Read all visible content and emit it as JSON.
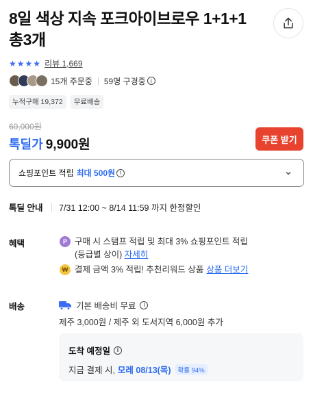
{
  "product": {
    "title": "8일 색상 지속 포크아이브로우 1+1+1 총3개"
  },
  "rating": {
    "stars": 4,
    "review_text": "리뷰 1,669"
  },
  "buyers": {
    "orders_text": "15개 주문중",
    "viewers_text": "59명 구경중"
  },
  "chips": [
    "누적구매 19,372",
    "무료배송"
  ],
  "price": {
    "original": "60,000원",
    "deal_label": "톡딜가",
    "current": "9,900원",
    "coupon_button": "쿠폰 받기"
  },
  "points": {
    "label": "쇼핑포인트 적립",
    "highlight": "최대 500원"
  },
  "deal_info": {
    "label": "톡딜 안내",
    "value": "7/31 12:00 ~ 8/14 11:59 까지 한정할인"
  },
  "benefits": {
    "label": "혜택",
    "item1_text": "구매 시 스탬프 적립 및 최대 3% 쇼핑포인트 적립",
    "item1_sub": "(등급별 상이)",
    "item1_link": "자세히",
    "item1_icon": "P",
    "item2_text": "결제 금액 3% 적립! 추천리워드 상품",
    "item2_link": "상품 더보기",
    "item2_icon": "₩"
  },
  "shipping": {
    "label": "배송",
    "base": "기본 배송비 무료",
    "extra": "제주 3,000원 / 제주 외 도서지역 6,000원 추가",
    "arrival_title": "도착 예정일",
    "arrival_prefix": "지금 결제 시,",
    "arrival_date": "모레 08/13(목)",
    "arrival_prob": "확률 94%"
  },
  "colors": {
    "accent": "#2c6cf0",
    "coupon": "#e8432e"
  }
}
